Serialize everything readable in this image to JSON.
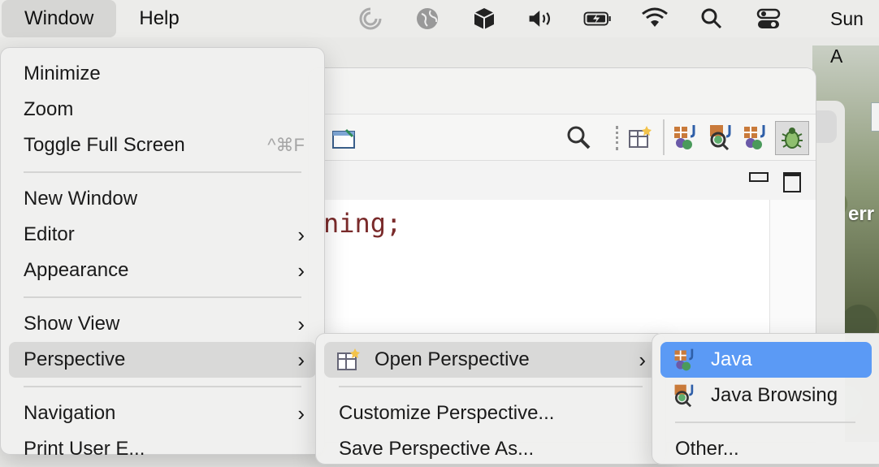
{
  "menubar": {
    "items": [
      "Window",
      "Help"
    ],
    "clock": "Sun A"
  },
  "status_icons": [
    "timer-icon",
    "globe-icon",
    "box-icon",
    "volume-icon",
    "battery-charging-icon",
    "wifi-icon",
    "search-icon",
    "control-center-icon"
  ],
  "editor": {
    "visible_text": "ning;"
  },
  "desktop": {
    "label": "err"
  },
  "window_menu": {
    "items": [
      {
        "label": "Minimize"
      },
      {
        "label": "Zoom"
      },
      {
        "label": "Toggle Full Screen",
        "shortcut": "^⌘F"
      },
      {
        "label": "New Window"
      },
      {
        "label": "Editor",
        "submenu": true
      },
      {
        "label": "Appearance",
        "submenu": true
      },
      {
        "label": "Show View",
        "submenu": true
      },
      {
        "label": "Perspective",
        "submenu": true,
        "highlighted": true
      },
      {
        "label": "Navigation",
        "submenu": true
      },
      {
        "label": "Print User E..."
      }
    ]
  },
  "perspective_menu": {
    "items": [
      {
        "label": "Open Perspective",
        "submenu": true,
        "highlighted": true
      },
      {
        "label": "Customize Perspective..."
      },
      {
        "label": "Save Perspective As..."
      }
    ]
  },
  "open_perspective_menu": {
    "items": [
      {
        "label": "Java",
        "selected": true
      },
      {
        "label": "Java Browsing"
      },
      {
        "label": "Other..."
      }
    ]
  },
  "colors": {
    "selection": "#5b9af5",
    "menu_bg": "#f0f0ef"
  }
}
